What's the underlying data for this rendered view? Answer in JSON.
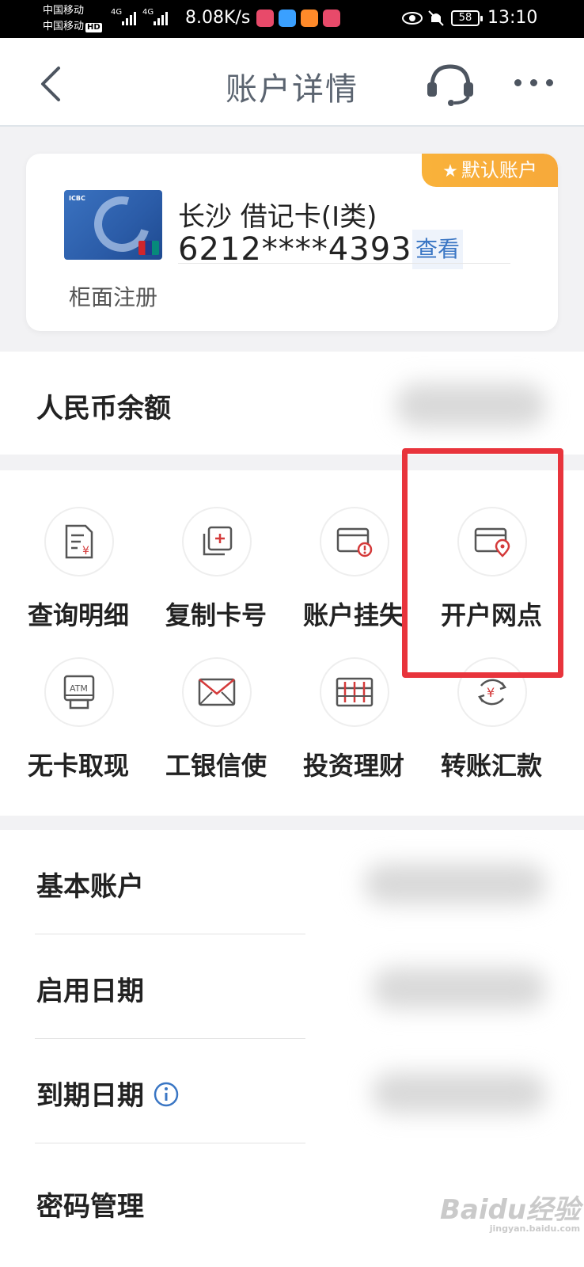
{
  "status_bar": {
    "carrier_1": "中国移动",
    "carrier_2": "中国移动",
    "hd": "HD",
    "net_1": "4G",
    "net_2": "4G",
    "speed": "8.08K/s",
    "battery": "58",
    "time": "13:10"
  },
  "header": {
    "title": "账户详情"
  },
  "card": {
    "badge": "默认账户",
    "name": "长沙 借记卡(I类)",
    "number": "6212****4393",
    "view_label": "查看",
    "registration": "柜面注册",
    "card_logo": "ICBC"
  },
  "balance": {
    "label": "人民币余额"
  },
  "functions": [
    {
      "label": "查询明细",
      "icon": "statement-icon"
    },
    {
      "label": "复制卡号",
      "icon": "copy-card-icon"
    },
    {
      "label": "账户挂失",
      "icon": "report-loss-icon"
    },
    {
      "label": "开户网点",
      "icon": "branch-location-icon"
    },
    {
      "label": "无卡取现",
      "icon": "atm-icon"
    },
    {
      "label": "工银信使",
      "icon": "envelope-icon"
    },
    {
      "label": "投资理财",
      "icon": "abacus-icon"
    },
    {
      "label": "转账汇款",
      "icon": "transfer-icon"
    }
  ],
  "details": [
    {
      "label": "基本账户"
    },
    {
      "label": "启用日期"
    },
    {
      "label": "到期日期"
    },
    {
      "label": "密码管理"
    }
  ],
  "watermark": {
    "text": "Baidu经验",
    "sub": "jingyan.baidu.com"
  },
  "colors": {
    "highlight": "#e8343c",
    "badge": "#f7a93a",
    "link": "#3a76c4"
  }
}
